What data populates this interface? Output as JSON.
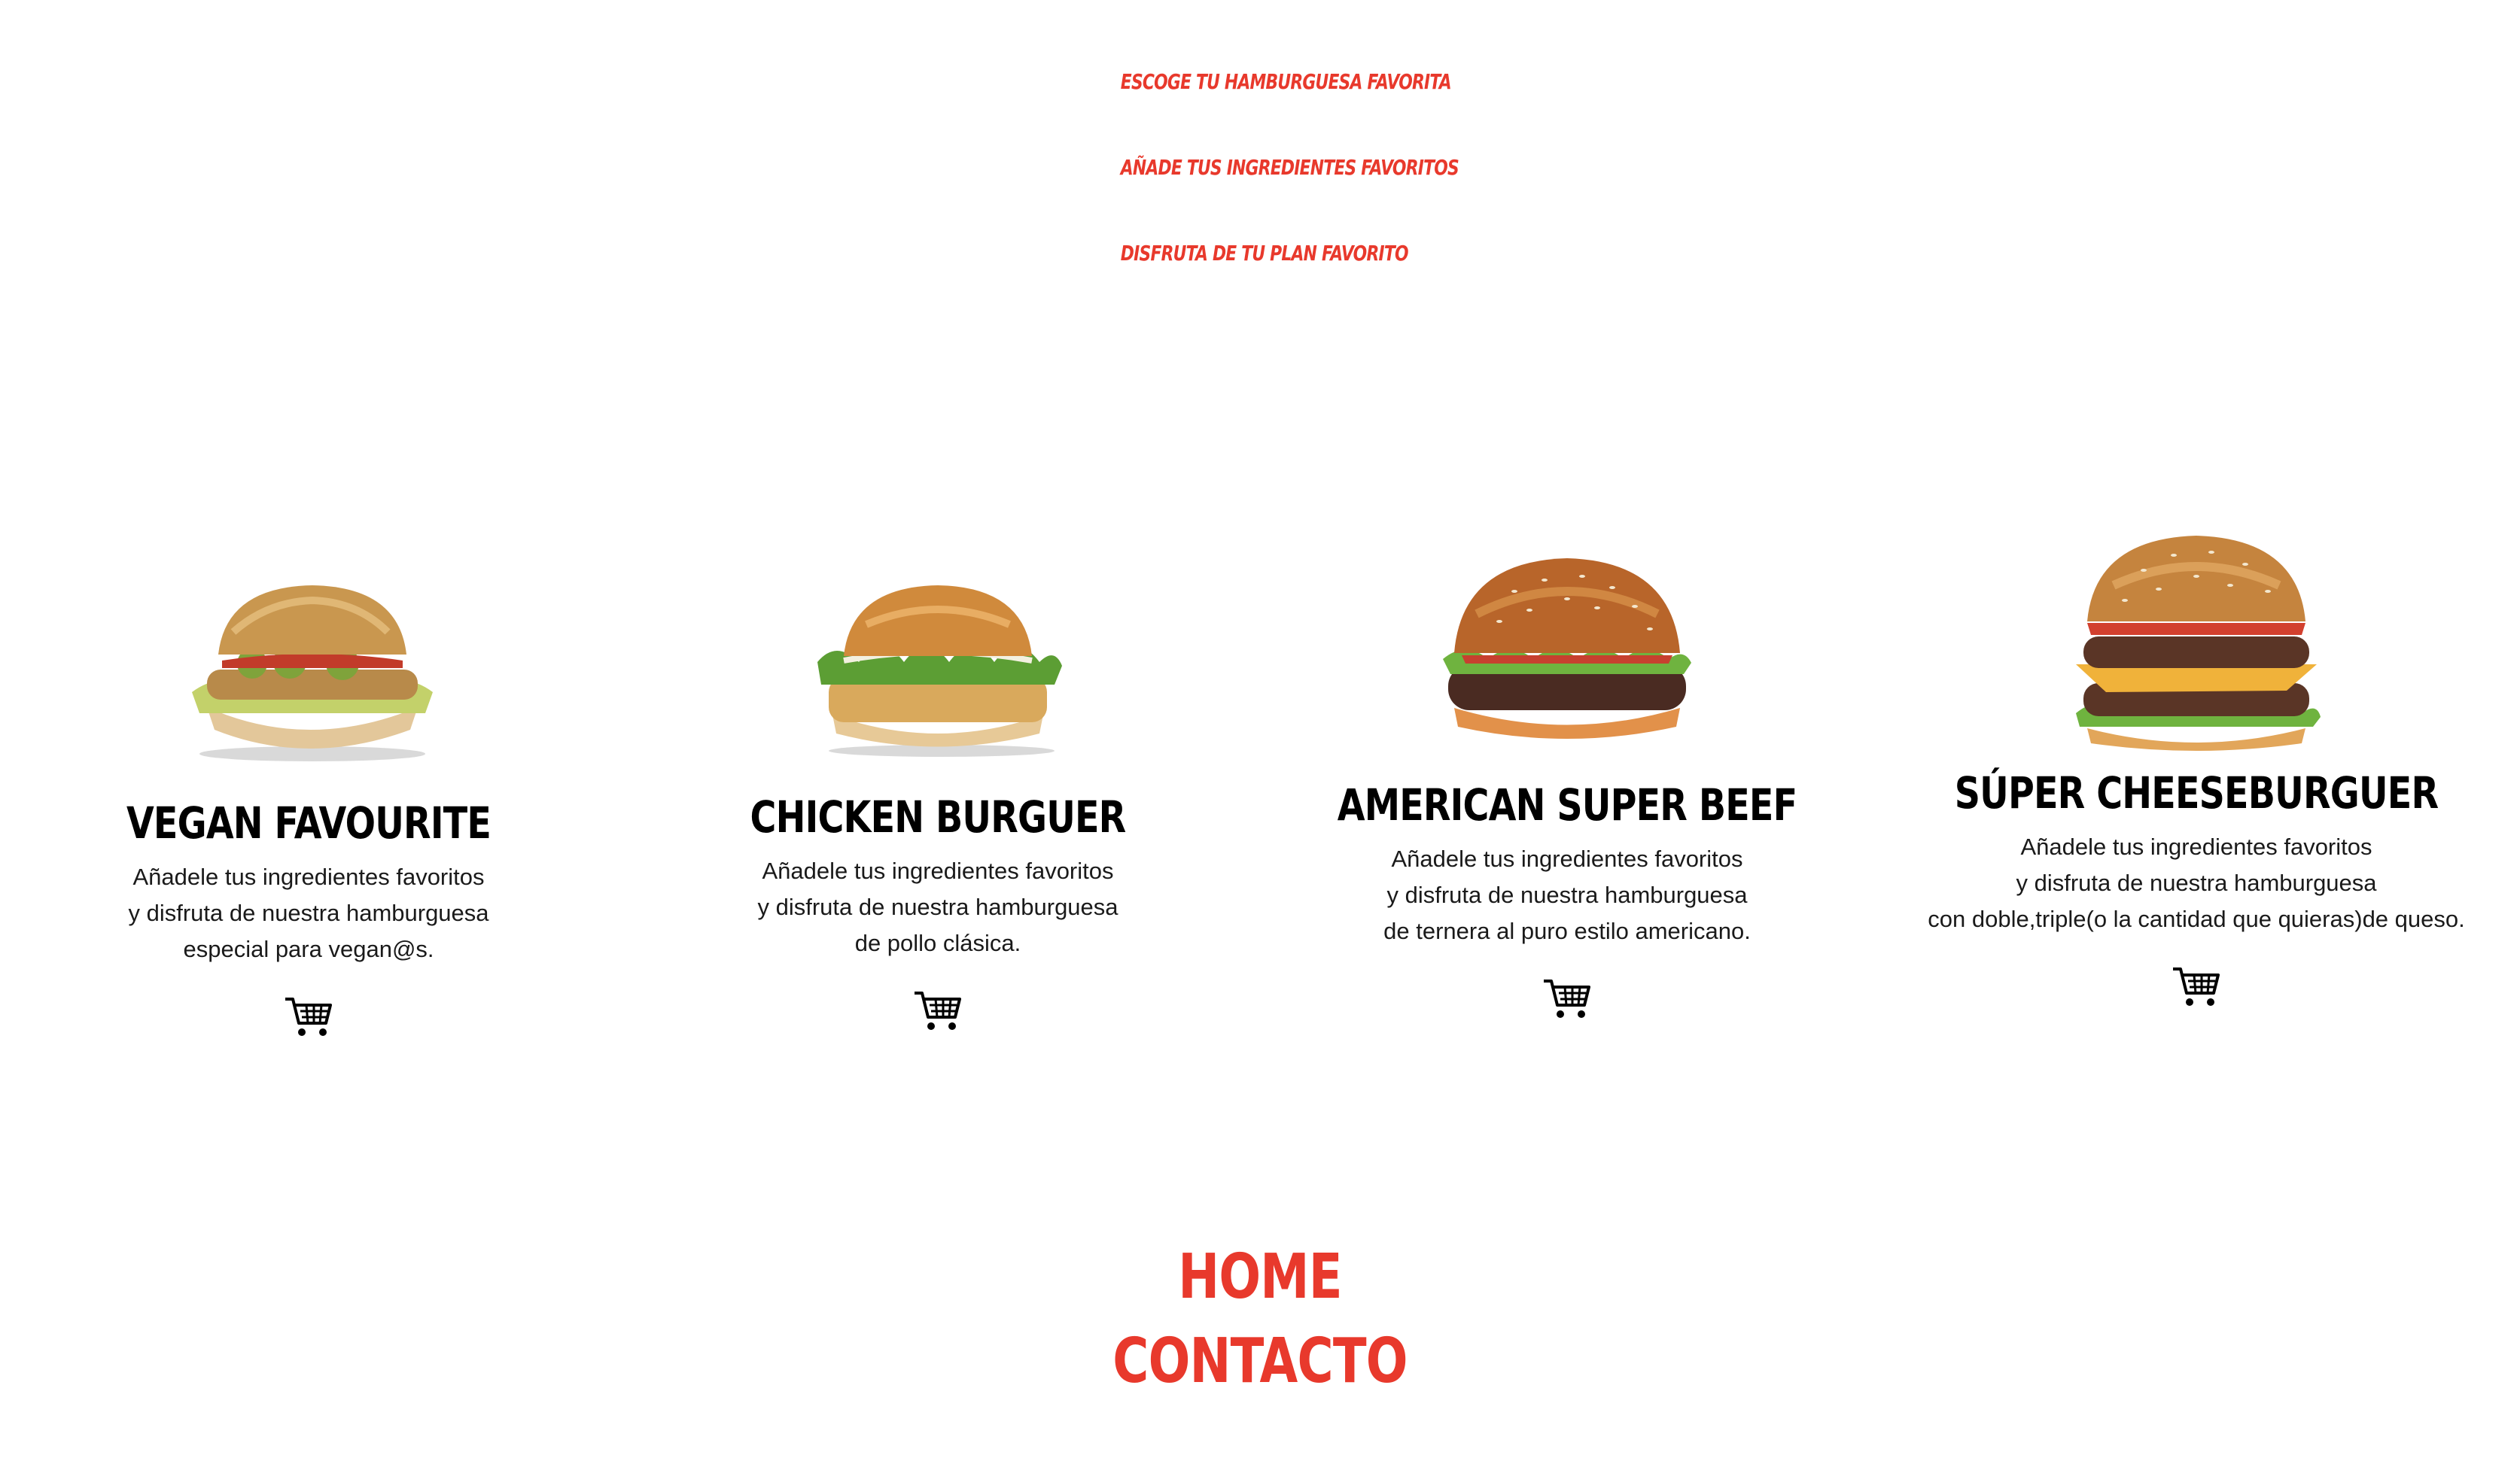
{
  "steps": [
    "ESCOGE TU HAMBURGUESA FAVORITA",
    "AÑADE TUS INGREDIENTES FAVORITOS",
    "DISFRUTA DE TU PLAN FAVORITO"
  ],
  "products": [
    {
      "title": "VEGAN FAVOURITE",
      "desc": [
        "Añadele tus ingredientes favoritos",
        "y disfruta de nuestra hamburguesa",
        "especial para vegan@s."
      ],
      "icon": "cart-icon"
    },
    {
      "title": "CHICKEN BURGUER",
      "desc": [
        "Añadele tus ingredientes favoritos",
        "y disfruta de nuestra hamburguesa",
        "de pollo clásica."
      ],
      "icon": "cart-icon"
    },
    {
      "title": "AMERICAN SUPER BEEF",
      "desc": [
        "Añadele tus ingredientes favoritos",
        "y disfruta de nuestra hamburguesa",
        "de ternera al puro estilo americano."
      ],
      "icon": "cart-icon"
    },
    {
      "title": "SÚPER CHEESEBURGUER",
      "desc": [
        "Añadele tus ingredientes favoritos",
        "y disfruta de nuestra hamburguesa",
        "con doble,triple(o la cantidad que quieras)de queso."
      ],
      "icon": "cart-icon"
    }
  ],
  "footer": {
    "home": "HOME",
    "contact": "CONTACTO"
  },
  "colors": {
    "accent": "#e8392c",
    "text": "#000000"
  }
}
